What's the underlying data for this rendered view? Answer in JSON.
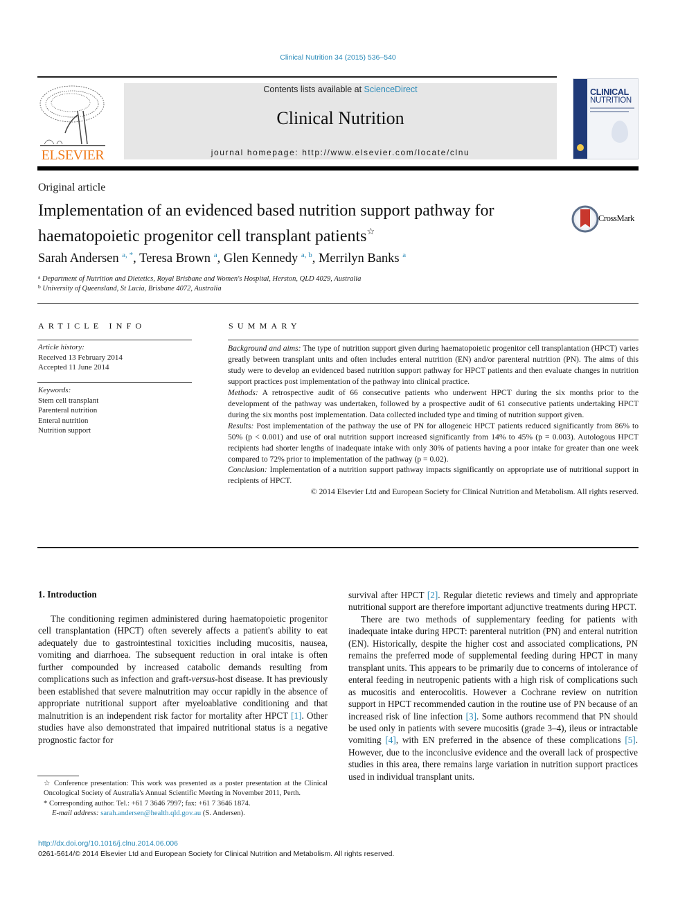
{
  "header": {
    "citation": "Clinical Nutrition 34 (2015) 536–540",
    "publisher_wordmark": "ELSEVIER",
    "contents_prefix": "Contents lists available at ",
    "contents_link": "ScienceDirect",
    "journal_title": "Clinical Nutrition",
    "homepage_line": "journal homepage: http://www.elsevier.com/locate/clnu",
    "cover": {
      "line1": "CLINICAL",
      "line2": "NUTRITION"
    },
    "colors": {
      "link": "#2a8ab8",
      "elsevier_orange": "#f07a1a",
      "cover_navy": "#1f3a78",
      "masthead_bg": "#e6e6e6"
    }
  },
  "article": {
    "section_label": "Original article",
    "title": "Implementation of an evidenced based nutrition support pathway for haematopoietic progenitor cell transplant patients",
    "title_mark": "☆",
    "crossmark_label": "CrossMark",
    "authors": [
      {
        "name": "Sarah Andersen",
        "sup": "a, *"
      },
      {
        "name": "Teresa Brown",
        "sup": "a"
      },
      {
        "name": "Glen Kennedy",
        "sup": "a, b"
      },
      {
        "name": "Merrilyn Banks",
        "sup": "a"
      }
    ],
    "affiliations": [
      {
        "key": "a",
        "text": "Department of Nutrition and Dietetics, Royal Brisbane and Women's Hospital, Herston, QLD 4029, Australia"
      },
      {
        "key": "b",
        "text": "University of Queensland, St Lucia, Brisbane 4072, Australia"
      }
    ]
  },
  "article_info": {
    "heading": "ARTICLE INFO",
    "history_label": "Article history:",
    "received": "Received 13 February 2014",
    "accepted": "Accepted 11 June 2014",
    "keywords_label": "Keywords:",
    "keywords": [
      "Stem cell transplant",
      "Parenteral nutrition",
      "Enteral nutrition",
      "Nutrition support"
    ]
  },
  "summary": {
    "heading": "SUMMARY",
    "sections": [
      {
        "label": "Background and aims:",
        "text": " The type of nutrition support given during haematopoietic progenitor cell transplantation (HPCT) varies greatly between transplant units and often includes enteral nutrition (EN) and/or parenteral nutrition (PN). The aims of this study were to develop an evidenced based nutrition support pathway for HPCT patients and then evaluate changes in nutrition support practices post implementation of the pathway into clinical practice."
      },
      {
        "label": "Methods:",
        "text": " A retrospective audit of 66 consecutive patients who underwent HPCT during the six months prior to the development of the pathway was undertaken, followed by a prospective audit of 61 consecutive patients undertaking HPCT during the six months post implementation. Data collected included type and timing of nutrition support given."
      },
      {
        "label": "Results:",
        "text": " Post implementation of the pathway the use of PN for allogeneic HPCT patients reduced significantly from 86% to 50% (p < 0.001) and use of oral nutrition support increased significantly from 14% to 45% (p = 0.003). Autologous HPCT recipients had shorter lengths of inadequate intake with only 30% of patients having a poor intake for greater than one week compared to 72% prior to implementation of the pathway (p = 0.02)."
      },
      {
        "label": "Conclusion:",
        "text": " Implementation of a nutrition support pathway impacts significantly on appropriate use of nutritional support in recipients of HPCT."
      }
    ],
    "copyright": "© 2014 Elsevier Ltd and European Society for Clinical Nutrition and Metabolism. All rights reserved."
  },
  "body": {
    "intro_heading": "1.  Introduction",
    "left_para": [
      {
        "text": "The conditioning regimen administered during haematopoietic progenitor cell transplantation (HPCT) often severely affects a pa­tient's ability to eat adequately due to gastrointestinal toxicities including mucositis, nausea, vomiting and diarrhoea. The subse­quent reduction in oral intake is often further compounded by increased catabolic demands resulting from complications such as infection and graft-"
      },
      {
        "italic": "versus"
      },
      {
        "text": "-host disease. It has previously been established that severe malnutrition may occur rapidly in the absence of appropriate nutritional support after myeloablative conditioning and that malnutrition is an independent risk factor for mortality after HPCT "
      },
      {
        "ref": "[1]"
      },
      {
        "text": ". Other studies have also demonstrated that impaired nutritional status is a negative prognostic factor for"
      }
    ],
    "right_para1": [
      {
        "text": "survival after HPCT "
      },
      {
        "ref": "[2]"
      },
      {
        "text": ". Regular dietetic reviews and timely and appropriate nutritional support are therefore important adjunctive treatments during HPCT."
      }
    ],
    "right_para2": [
      {
        "text": "There are two methods of supplementary feeding for patients with inadequate intake during HPCT: parenteral nutrition (PN) and enteral nutrition (EN). Historically, despite the higher cost and associated complications, PN remains the preferred mode of sup­plemental feeding during HPCT in many transplant units. This ap­pears to be primarily due to concerns of intolerance of enteral feeding in neutropenic patients with a high risk of complications such as mucositis and enterocolitis. However a Cochrane review on nutrition support in HPCT recommended caution in the routine use of PN because of an increased risk of line infection "
      },
      {
        "ref": "[3]"
      },
      {
        "text": ". Some au­thors recommend that PN should be used only in patients with severe mucositis (grade 3–4), ileus or intractable vomiting "
      },
      {
        "ref": "[4]"
      },
      {
        "text": ", with EN preferred in the absence of these complications "
      },
      {
        "ref": "[5]"
      },
      {
        "text": ". However, due to the inconclusive evidence and the overall lack of prospective studies in this area, there remains large variation in nutrition support practices used in individual transplant units."
      }
    ]
  },
  "footnotes": {
    "conference": "☆  Conference presentation: This work was presented as a poster presentation at the Clinical Oncological Society of Australia's Annual Scientific Meeting in November 2011, Perth.",
    "corresponding": "*  Corresponding author. Tel.: +61 7 3646 7997; fax: +61 7 3646 1874.",
    "email_label": "E-mail address:",
    "email": "sarah.andersen@health.qld.gov.au",
    "email_suffix": " (S. Andersen)."
  },
  "footer": {
    "doi": "http://dx.doi.org/10.1016/j.clnu.2014.06.006",
    "issn_line": "0261-5614/© 2014 Elsevier Ltd and European Society for Clinical Nutrition and Metabolism. All rights reserved."
  }
}
